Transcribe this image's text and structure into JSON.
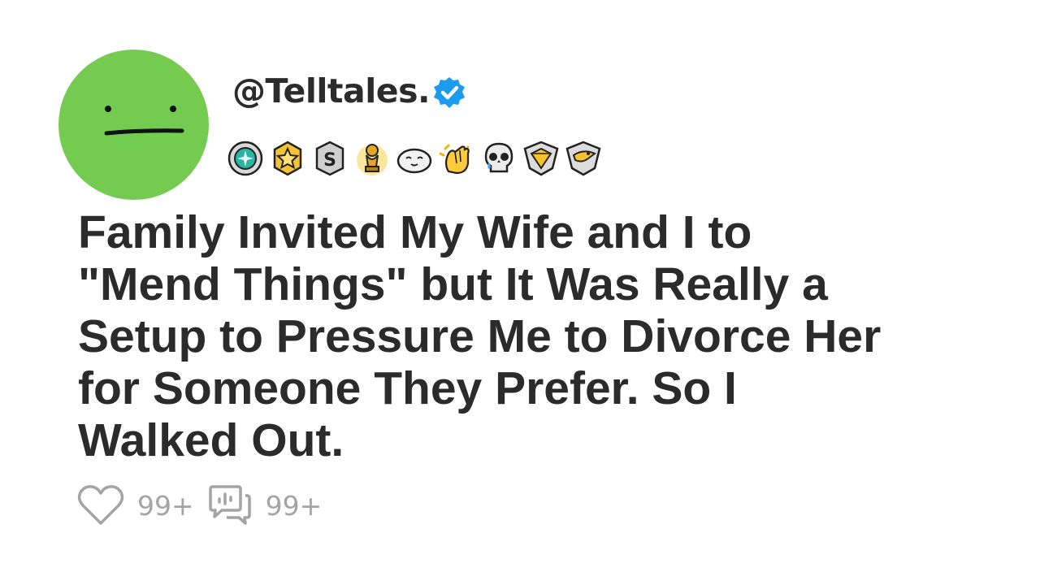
{
  "post": {
    "handle": "@Telltales.",
    "title_lines": [
      "Family Invited My Wife and I to",
      "\"Mend Things\" but It Was Really a",
      "Setup to Pressure Me to Divorce Her",
      "for Someone They Prefer. So I",
      "Walked Out."
    ],
    "likes": "99+",
    "comments": "99+"
  },
  "avatar": {
    "color": "#73cc4f",
    "icon": "neutral-face"
  },
  "verified_badge": {
    "icon": "verified-check-icon",
    "color": "#1d9bf0"
  },
  "award_badges": [
    "teal-gem-medal",
    "gold-star-medal",
    "silver-s-medal",
    "gold-trophy",
    "sleeping-seal",
    "clapping-hands",
    "skull-tear",
    "gold-diamond-shield",
    "bird-shield"
  ],
  "colors": {
    "text": "#2b2b2b",
    "muted": "#a4a4a4"
  }
}
